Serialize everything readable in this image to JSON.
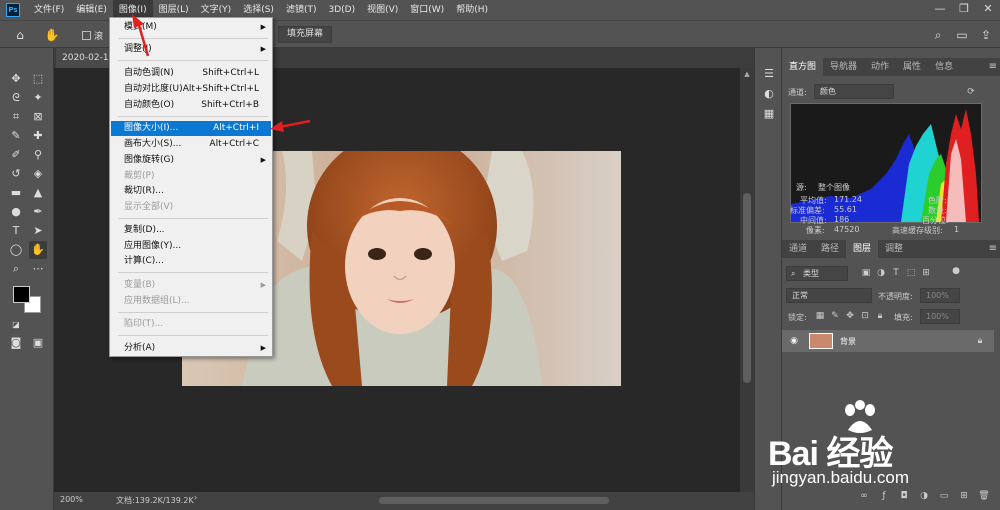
{
  "app": {
    "logo": "Ps"
  },
  "menubar": {
    "items": [
      "文件(F)",
      "编辑(E)",
      "图像(I)",
      "图层(L)",
      "文字(Y)",
      "选择(S)",
      "滤镜(T)",
      "3D(D)",
      "视图(V)",
      "窗口(W)",
      "帮助(H)"
    ]
  },
  "window_controls": {
    "minimize": "—",
    "restore": "❐",
    "close": "✕"
  },
  "options_bar": {
    "fill_screen_label": "填充屏幕",
    "scroll_all_label": "滚"
  },
  "document": {
    "tab_title": "2020-02-13",
    "zoom": "200%",
    "file_info": "文档:139.2K/139.2K"
  },
  "image_menu": {
    "groups": [
      [
        {
          "label": "模式(M)",
          "shortcut": "",
          "submenu": true,
          "disabled": false
        }
      ],
      [
        {
          "label": "调整(J)",
          "shortcut": "",
          "submenu": true,
          "disabled": false
        }
      ],
      [
        {
          "label": "自动色调(N)",
          "shortcut": "Shift+Ctrl+L",
          "submenu": false,
          "disabled": false
        },
        {
          "label": "自动对比度(U)",
          "shortcut": "Alt+Shift+Ctrl+L",
          "submenu": false,
          "disabled": false
        },
        {
          "label": "自动颜色(O)",
          "shortcut": "Shift+Ctrl+B",
          "submenu": false,
          "disabled": false
        }
      ],
      [
        {
          "label": "图像大小(I)...",
          "shortcut": "Alt+Ctrl+I",
          "submenu": false,
          "disabled": false,
          "highlight": true
        },
        {
          "label": "画布大小(S)...",
          "shortcut": "Alt+Ctrl+C",
          "submenu": false,
          "disabled": false
        },
        {
          "label": "图像旋转(G)",
          "shortcut": "",
          "submenu": true,
          "disabled": false
        },
        {
          "label": "裁剪(P)",
          "shortcut": "",
          "submenu": false,
          "disabled": true
        },
        {
          "label": "裁切(R)...",
          "shortcut": "",
          "submenu": false,
          "disabled": false
        },
        {
          "label": "显示全部(V)",
          "shortcut": "",
          "submenu": false,
          "disabled": true
        }
      ],
      [
        {
          "label": "复制(D)...",
          "shortcut": "",
          "submenu": false,
          "disabled": false
        },
        {
          "label": "应用图像(Y)...",
          "shortcut": "",
          "submenu": false,
          "disabled": false
        },
        {
          "label": "计算(C)...",
          "shortcut": "",
          "submenu": false,
          "disabled": false
        }
      ],
      [
        {
          "label": "变量(B)",
          "shortcut": "",
          "submenu": true,
          "disabled": true
        },
        {
          "label": "应用数据组(L)...",
          "shortcut": "",
          "submenu": false,
          "disabled": true
        }
      ],
      [
        {
          "label": "陷印(T)...",
          "shortcut": "",
          "submenu": false,
          "disabled": true
        }
      ],
      [
        {
          "label": "分析(A)",
          "shortcut": "",
          "submenu": true,
          "disabled": false
        }
      ]
    ]
  },
  "histogram_panel": {
    "tabs": [
      "直方图",
      "导航器",
      "动作",
      "属性",
      "信息"
    ],
    "channel_label": "通道:",
    "channel_value": "颜色",
    "source_label": "源:",
    "source_value": "整个图像",
    "stats": {
      "mean_label": "平均值:",
      "mean": "171.24",
      "stddev_label": "标准偏差:",
      "stddev": "55.61",
      "median_label": "中间值:",
      "median": "186",
      "pixels_label": "像素:",
      "pixels": "47520",
      "level_label": "色阶:",
      "count_label": "数量:",
      "percentile_label": "百分位:",
      "cache_label": "高速缓存级别:",
      "cache": "1"
    }
  },
  "layers_panel": {
    "tabs": [
      "通道",
      "路径",
      "图层",
      "调整"
    ],
    "filter_label": "类型",
    "blend_mode": "正常",
    "opacity_label": "不透明度:",
    "opacity": "100%",
    "lock_label": "锁定:",
    "fill_label": "填充:",
    "fill": "100%",
    "layer_name": "背景"
  },
  "watermark": {
    "brand": "Bai 经验",
    "url": "jingyan.baidu.com"
  },
  "colors": {
    "accent": "#0b78d4",
    "annotation": "#e02020",
    "panel": "#535353",
    "canvas": "#282828"
  }
}
